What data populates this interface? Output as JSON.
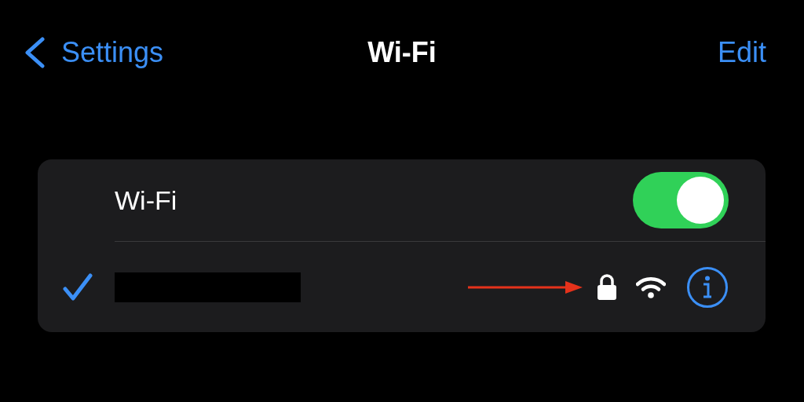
{
  "nav": {
    "back_label": "Settings",
    "title": "Wi-Fi",
    "action": "Edit"
  },
  "wifi_row": {
    "label": "Wi-Fi",
    "on": true
  },
  "network": {
    "connected": true,
    "redacted": true,
    "secured": true
  },
  "annotations": [
    {
      "kind": "arrow"
    }
  ]
}
